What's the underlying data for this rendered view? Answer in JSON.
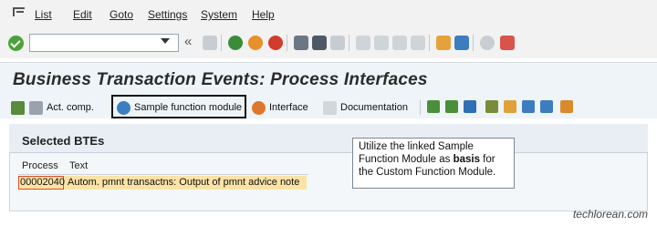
{
  "menu": {
    "items": [
      "List",
      "Edit",
      "Goto",
      "Settings",
      "System",
      "Help"
    ]
  },
  "toolbar": {
    "command_value": ""
  },
  "title": "Business Transaction Events: Process Interfaces",
  "app_toolbar": {
    "act_comp": "Act. comp.",
    "sample_function_module": "Sample function module",
    "interface": "Interface",
    "documentation": "Documentation"
  },
  "section": {
    "title": "Selected BTEs",
    "columns": [
      "Process",
      "Text"
    ],
    "rows": [
      {
        "process": "00002040",
        "text": "Autom. pmnt transactns: Output of pmnt advice note"
      }
    ]
  },
  "callout": {
    "part1": "Utilize the linked Sample Function Module as ",
    "bold": "basis",
    "part2": " for the Custom Function Module."
  },
  "footer": "techlorean.com"
}
